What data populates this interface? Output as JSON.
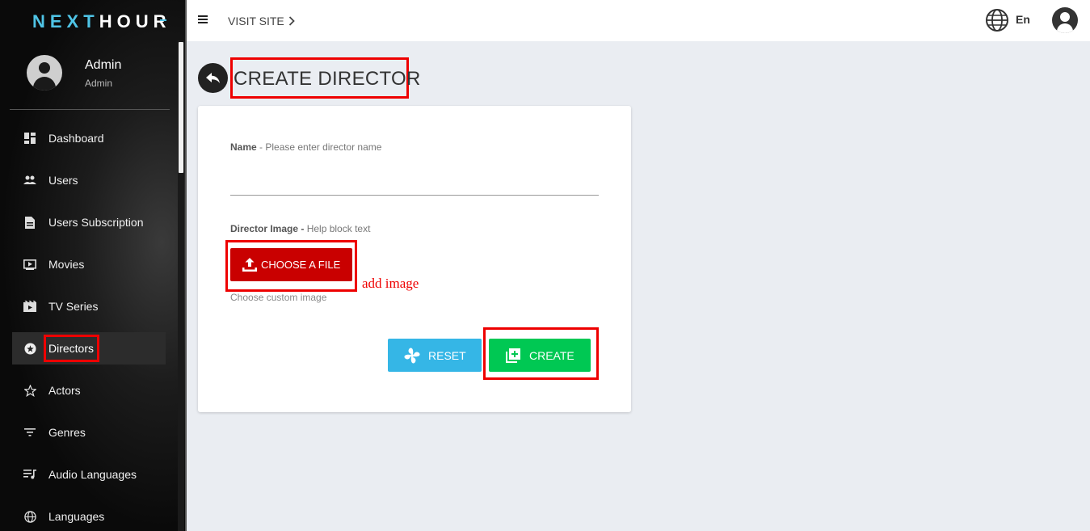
{
  "brand": {
    "part1": "NEXT",
    "part2": "HOUR"
  },
  "profile": {
    "name": "Admin",
    "role": "Admin"
  },
  "sidebar": {
    "items": [
      {
        "label": "Dashboard",
        "icon": "dashboard-icon"
      },
      {
        "label": "Users",
        "icon": "users-icon"
      },
      {
        "label": "Users Subscription",
        "icon": "document-icon"
      },
      {
        "label": "Movies",
        "icon": "movie-icon"
      },
      {
        "label": "TV Series",
        "icon": "tv-series-icon"
      },
      {
        "label": "Directors",
        "icon": "star-circle-icon",
        "active": true
      },
      {
        "label": "Actors",
        "icon": "star-outline-icon"
      },
      {
        "label": "Genres",
        "icon": "filter-icon"
      },
      {
        "label": "Audio Languages",
        "icon": "music-list-icon"
      },
      {
        "label": "Languages",
        "icon": "globe-icon"
      }
    ]
  },
  "topbar": {
    "visit_site": "VISIT SITE",
    "language": "En"
  },
  "page": {
    "title": "CREATE DIRECTOR"
  },
  "form": {
    "name_label": "Name",
    "name_help": "- Please enter director name",
    "name_value": "",
    "image_label": "Director Image -",
    "image_help": "Help block text",
    "choose_file_label": "CHOOSE A FILE",
    "custom_image_text": "Choose custom image",
    "annotation": "add image",
    "reset_label": "RESET",
    "create_label": "CREATE"
  },
  "colors": {
    "accent_blue": "#35b6e6",
    "create_green": "#00c853",
    "choose_red": "#c90000",
    "highlight_red": "#e00000"
  }
}
